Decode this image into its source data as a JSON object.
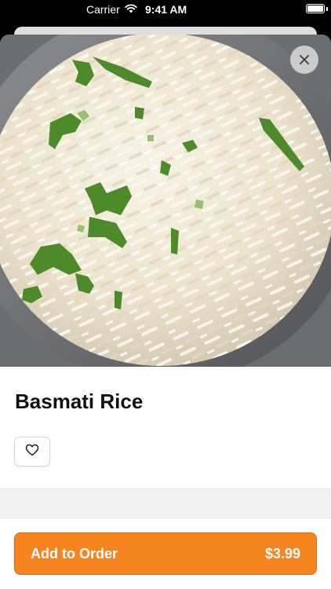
{
  "status_bar": {
    "carrier": "Carrier",
    "time": "9:41 AM"
  },
  "item": {
    "name": "Basmati Rice",
    "image_alt": "Bowl of basmati rice garnished with cilantro"
  },
  "order_button": {
    "label": "Add to Order",
    "price": "$3.99"
  },
  "icons": {
    "close": "close-icon",
    "favorite": "heart-icon",
    "wifi": "wifi-icon",
    "battery": "battery-icon"
  },
  "colors": {
    "accent": "#f5851f",
    "accent_border": "#d4691a",
    "title_text": "#111111"
  }
}
